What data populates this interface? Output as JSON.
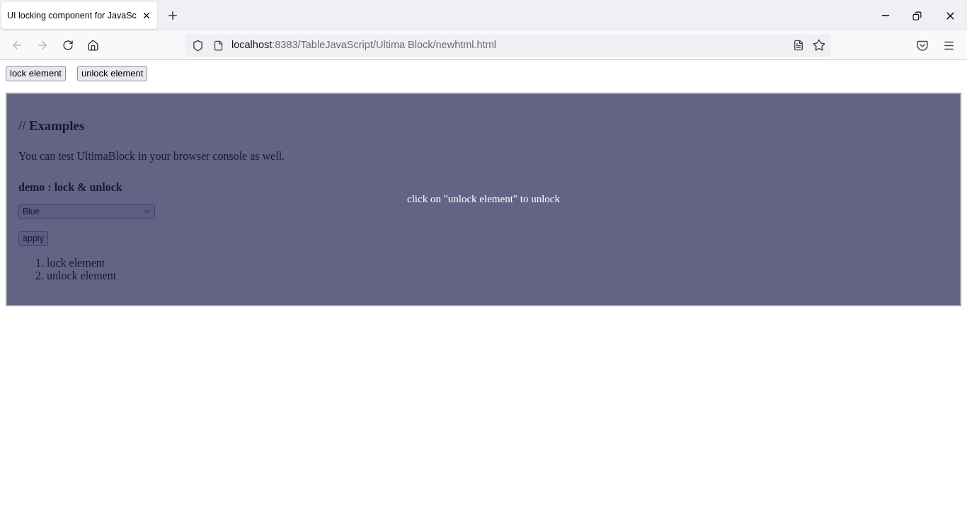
{
  "browser": {
    "tab": {
      "title": "UI locking component for JavaSc",
      "selected": true
    },
    "url": {
      "host": "localhost",
      "path": ":8383/TableJavaScript/Ultima Block/newhtml.html"
    },
    "back_disabled": true,
    "forward_disabled": true
  },
  "toolbar_buttons": [
    "lock element",
    "unlock element"
  ],
  "panel": {
    "locked": true,
    "heading_prefix": "//",
    "heading": "Examples",
    "intro": "You can test UltimaBlock in your browser console as well.",
    "subheading": "demo : lock & unlock",
    "select": {
      "value": "Blue"
    },
    "apply": "apply",
    "steps": [
      {
        "number": "1.",
        "text": "lock element"
      },
      {
        "number": "2.",
        "text": "unlock element"
      }
    ],
    "overlay_message": "click on \"unlock element\" to unlock"
  }
}
